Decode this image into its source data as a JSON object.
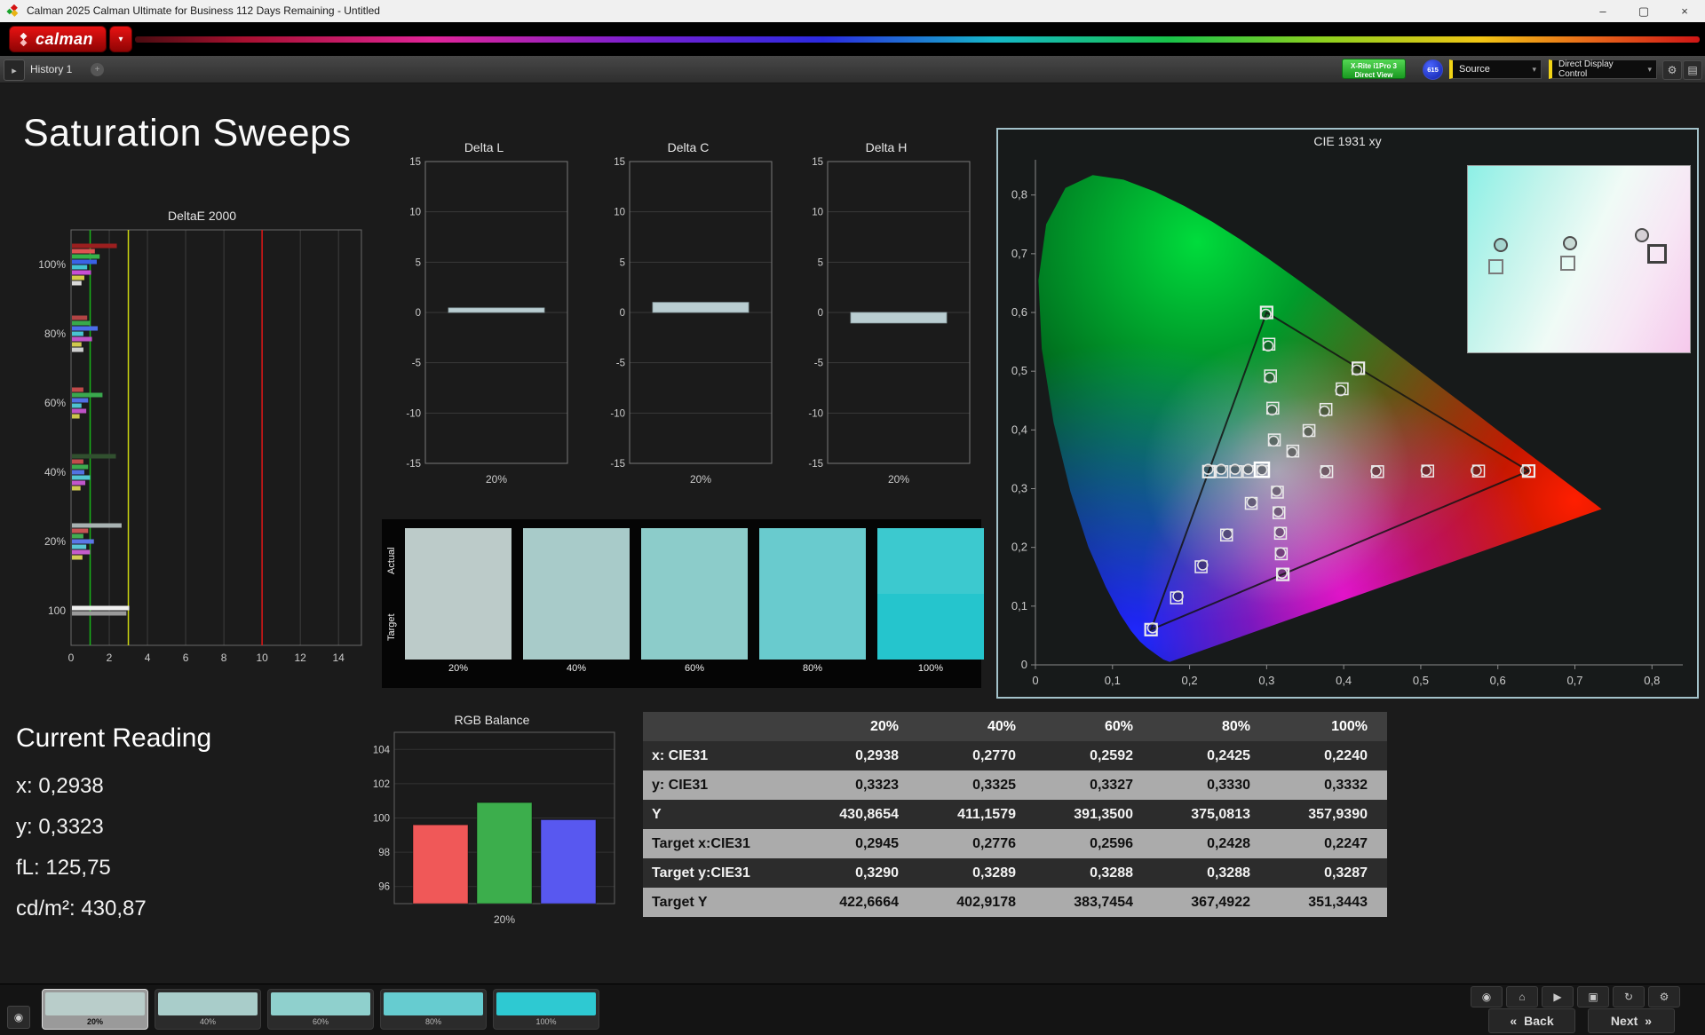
{
  "window": {
    "title": "Calman 2025 Calman Ultimate for Business 112 Days Remaining  - Untitled",
    "controls": {
      "minimize": "–",
      "maximize": "▢",
      "close": "×"
    }
  },
  "brand": {
    "logo_text": "calman",
    "dropdown_glyph": "▾"
  },
  "toolbar": {
    "history_tab": "History 1",
    "history_add": "+",
    "expand_glyph": "▸",
    "meter": {
      "line1": "X-Rite i1Pro 3",
      "line2": "Direct View"
    },
    "badge": "615",
    "source": "Source",
    "display_control": "Direct Display Control",
    "arrow_glyph": "▾",
    "gear_glyph": "⚙",
    "panel_glyph": "▤"
  },
  "page_title": "Saturation Sweeps",
  "current_reading": {
    "title": "Current Reading",
    "lines": [
      "x: 0,2938",
      "y: 0,3323",
      "fL: 125,75",
      "cd/m²: 430,87"
    ]
  },
  "charts": {
    "deltae": {
      "type": "bar",
      "title": "DeltaE 2000",
      "xticks": [
        0,
        2,
        4,
        6,
        8,
        10,
        12,
        14
      ],
      "xmax": 15.2,
      "ref_lines": [
        {
          "v": 1,
          "c": "#18b418"
        },
        {
          "v": 3,
          "c": "#cdd812"
        },
        {
          "v": 10,
          "c": "#e01616"
        }
      ],
      "groups": [
        {
          "label": "100%",
          "bars": [
            {
              "c": "#9c1f1f",
              "v": 2.35
            },
            {
              "c": "#e05252",
              "v": 1.2
            },
            {
              "c": "#35b24a",
              "v": 1.45
            },
            {
              "c": "#3a62e6",
              "v": 1.3
            },
            {
              "c": "#41c2d2",
              "v": 0.8
            },
            {
              "c": "#c64fd4",
              "v": 1.0
            },
            {
              "c": "#d3cc46",
              "v": 0.65
            },
            {
              "c": "#d9d9d9",
              "v": 0.5
            }
          ]
        },
        {
          "label": "80%",
          "bars": [
            {
              "c": "#b24444",
              "v": 0.8
            },
            {
              "c": "#38a94c",
              "v": 0.95
            },
            {
              "c": "#4b6ee8",
              "v": 1.35
            },
            {
              "c": "#49c4d2",
              "v": 0.6
            },
            {
              "c": "#bf54c8",
              "v": 1.05
            },
            {
              "c": "#cfc84e",
              "v": 0.5
            },
            {
              "c": "#cfcfcf",
              "v": 0.6
            }
          ]
        },
        {
          "label": "60%",
          "bars": [
            {
              "c": "#c04a4a",
              "v": 0.6
            },
            {
              "c": "#3aa84e",
              "v": 1.6
            },
            {
              "c": "#5070e4",
              "v": 0.85
            },
            {
              "c": "#4fc3d0",
              "v": 0.5
            },
            {
              "c": "#bd52c6",
              "v": 0.75
            },
            {
              "c": "#cbc44c",
              "v": 0.4
            }
          ]
        },
        {
          "label": "40%",
          "bars": [
            {
              "c": "#31502f",
              "v": 2.3
            },
            {
              "c": "#c24c4c",
              "v": 0.6
            },
            {
              "c": "#3cab4f",
              "v": 0.85
            },
            {
              "c": "#5272e2",
              "v": 0.65
            },
            {
              "c": "#52c5d2",
              "v": 0.95
            },
            {
              "c": "#c156ca",
              "v": 0.7
            },
            {
              "c": "#cec84f",
              "v": 0.45
            }
          ]
        },
        {
          "label": "20%",
          "bars": [
            {
              "c": "#a8b2b2",
              "v": 2.6
            },
            {
              "c": "#c65454",
              "v": 0.85
            },
            {
              "c": "#42ad52",
              "v": 0.6
            },
            {
              "c": "#5b77e6",
              "v": 1.15
            },
            {
              "c": "#58c7d4",
              "v": 0.75
            },
            {
              "c": "#c45ccb",
              "v": 0.95
            },
            {
              "c": "#d2cc55",
              "v": 0.55
            }
          ]
        },
        {
          "label": "100",
          "bars": [
            {
              "c": "#f0f0f0",
              "v": 3.0
            },
            {
              "c": "#9a9a9a",
              "v": 2.85
            }
          ]
        }
      ]
    },
    "mini_shared": {
      "yticks": [
        15,
        10,
        5,
        0,
        -5,
        -10,
        -15
      ],
      "ymin": -15,
      "ymax": 15,
      "xlabel": "20%",
      "bar_color": "#b9cdd1"
    },
    "mini": [
      {
        "title": "Delta L",
        "value": 0.45
      },
      {
        "title": "Delta C",
        "value": 1.0
      },
      {
        "title": "Delta H",
        "value": -1.05
      }
    ],
    "rgb": {
      "type": "bar",
      "title": "RGB Balance",
      "yticks": [
        104,
        102,
        100,
        98,
        96
      ],
      "ymin": 95,
      "ymax": 105,
      "xlabel": "20%",
      "bars": [
        {
          "c": "#f05858",
          "v": 99.6
        },
        {
          "c": "#3cae4c",
          "v": 100.9
        },
        {
          "c": "#5858f0",
          "v": 99.9
        }
      ]
    },
    "cie": {
      "title": "CIE 1931 xy",
      "xtick_vals": [
        0,
        0.1,
        0.2,
        0.3,
        0.4,
        0.5,
        0.6,
        0.7,
        0.8
      ],
      "xtick_labels": [
        "0",
        "0,1",
        "0,2",
        "0,3",
        "0,4",
        "0,5",
        "0,6",
        "0,7",
        "0,8"
      ],
      "ytick_vals": [
        0,
        0.1,
        0.2,
        0.3,
        0.4,
        0.5,
        0.6,
        0.7,
        0.8
      ],
      "ytick_labels": [
        "0",
        "0,1",
        "0,2",
        "0,3",
        "0,4",
        "0,5",
        "0,6",
        "0,7",
        "0,8"
      ],
      "xrange": [
        0,
        0.84
      ],
      "yrange": [
        0,
        0.86
      ],
      "triangle": [
        [
          0.64,
          0.33
        ],
        [
          0.3,
          0.6
        ],
        [
          0.15,
          0.06
        ]
      ],
      "current": [
        0.2938,
        0.3323
      ],
      "sweeps": [
        {
          "name": "red",
          "targets": [
            [
              0.378,
              0.329
            ],
            [
              0.444,
              0.329
            ],
            [
              0.509,
              0.33
            ],
            [
              0.575,
              0.33
            ],
            [
              0.64,
              0.33
            ]
          ],
          "measured": [
            [
              0.376,
              0.33
            ],
            [
              0.442,
              0.33
            ],
            [
              0.507,
              0.331
            ],
            [
              0.572,
              0.331
            ],
            [
              0.636,
              0.331
            ]
          ]
        },
        {
          "name": "green",
          "targets": [
            [
              0.31,
              0.383
            ],
            [
              0.308,
              0.437
            ],
            [
              0.305,
              0.492
            ],
            [
              0.303,
              0.546
            ],
            [
              0.3,
              0.6
            ]
          ],
          "measured": [
            [
              0.309,
              0.381
            ],
            [
              0.307,
              0.434
            ],
            [
              0.304,
              0.489
            ],
            [
              0.302,
              0.543
            ],
            [
              0.299,
              0.597
            ]
          ]
        },
        {
          "name": "blue",
          "targets": [
            [
              0.28,
              0.275
            ],
            [
              0.248,
              0.221
            ],
            [
              0.215,
              0.167
            ],
            [
              0.183,
              0.114
            ],
            [
              0.15,
              0.06
            ]
          ],
          "measured": [
            [
              0.281,
              0.277
            ],
            [
              0.249,
              0.223
            ],
            [
              0.217,
              0.17
            ],
            [
              0.185,
              0.117
            ],
            [
              0.152,
              0.063
            ]
          ]
        },
        {
          "name": "cyan",
          "targets": [
            [
              0.295,
              0.329
            ],
            [
              0.277,
              0.329
            ],
            [
              0.26,
              0.329
            ],
            [
              0.242,
              0.329
            ],
            [
              0.225,
              0.329
            ]
          ],
          "measured": [
            [
              0.294,
              0.332
            ],
            [
              0.276,
              0.333
            ],
            [
              0.259,
              0.333
            ],
            [
              0.241,
              0.333
            ],
            [
              0.224,
              0.333
            ]
          ]
        },
        {
          "name": "magenta",
          "targets": [
            [
              0.314,
              0.294
            ],
            [
              0.316,
              0.259
            ],
            [
              0.318,
              0.224
            ],
            [
              0.319,
              0.189
            ],
            [
              0.321,
              0.154
            ]
          ],
          "measured": [
            [
              0.313,
              0.296
            ],
            [
              0.315,
              0.261
            ],
            [
              0.317,
              0.226
            ],
            [
              0.318,
              0.191
            ],
            [
              0.32,
              0.156
            ]
          ]
        },
        {
          "name": "yellow",
          "targets": [
            [
              0.334,
              0.364
            ],
            [
              0.355,
              0.399
            ],
            [
              0.377,
              0.435
            ],
            [
              0.398,
              0.47
            ],
            [
              0.419,
              0.505
            ]
          ],
          "measured": [
            [
              0.333,
              0.362
            ],
            [
              0.354,
              0.397
            ],
            [
              0.375,
              0.432
            ],
            [
              0.396,
              0.467
            ],
            [
              0.417,
              0.502
            ]
          ]
        }
      ],
      "inset": {
        "circles": [
          [
            0.14,
            0.41
          ],
          [
            0.45,
            0.4
          ],
          [
            0.77,
            0.36
          ]
        ],
        "squares": [
          [
            0.12,
            0.53
          ],
          [
            0.44,
            0.51
          ],
          [
            0.83,
            0.45
          ]
        ]
      }
    }
  },
  "swatches": {
    "row_labels": [
      "Actual",
      "Target"
    ],
    "columns": [
      {
        "label": "20%",
        "actual": "#bccbc9",
        "target": "#bccbc9"
      },
      {
        "label": "40%",
        "actual": "#a8cbc9",
        "target": "#a8cbc9"
      },
      {
        "label": "60%",
        "actual": "#8cccca",
        "target": "#8cccca"
      },
      {
        "label": "80%",
        "actual": "#69cbce",
        "target": "#69cbce"
      },
      {
        "label": "100%",
        "actual": "#3cc9cf",
        "target": "#25c5cd"
      }
    ]
  },
  "table": {
    "col_headers": [
      "20%",
      "40%",
      "60%",
      "80%",
      "100%"
    ],
    "rows": [
      {
        "label": "x: CIE31",
        "shade": "dark",
        "values": [
          "0,2938",
          "0,2770",
          "0,2592",
          "0,2425",
          "0,2240"
        ]
      },
      {
        "label": "y: CIE31",
        "shade": "light",
        "values": [
          "0,3323",
          "0,3325",
          "0,3327",
          "0,3330",
          "0,3332"
        ]
      },
      {
        "label": "Y",
        "shade": "dark",
        "values": [
          "430,8654",
          "411,1579",
          "391,3500",
          "375,0813",
          "357,9390"
        ]
      },
      {
        "label": "Target x:CIE31",
        "shade": "light",
        "values": [
          "0,2945",
          "0,2776",
          "0,2596",
          "0,2428",
          "0,2247"
        ]
      },
      {
        "label": "Target y:CIE31",
        "shade": "dark",
        "values": [
          "0,3290",
          "0,3289",
          "0,3288",
          "0,3288",
          "0,3287"
        ]
      },
      {
        "label": "Target Y",
        "shade": "light",
        "values": [
          "422,6664",
          "402,9178",
          "383,7454",
          "367,4922",
          "351,3443"
        ]
      }
    ]
  },
  "bottom": {
    "swatch_buttons": [
      {
        "label": "20%",
        "color": "#b9cdca",
        "selected": true
      },
      {
        "label": "40%",
        "color": "#a9cdca",
        "selected": false
      },
      {
        "label": "60%",
        "color": "#8fd0cd",
        "selected": false
      },
      {
        "label": "80%",
        "color": "#66ccd0",
        "selected": false
      },
      {
        "label": "100%",
        "color": "#2ec9d2",
        "selected": false
      }
    ],
    "patch_eye_glyph": "◉",
    "icons": [
      {
        "name": "eye",
        "glyph": "◉"
      },
      {
        "name": "home",
        "glyph": "⌂"
      },
      {
        "name": "play",
        "glyph": "▶"
      },
      {
        "name": "save",
        "glyph": "▣"
      },
      {
        "name": "refresh",
        "glyph": "↻"
      },
      {
        "name": "gear",
        "glyph": "⚙"
      }
    ],
    "back": "Back",
    "next": "Next",
    "back_glyph": "«",
    "next_glyph": "»"
  }
}
